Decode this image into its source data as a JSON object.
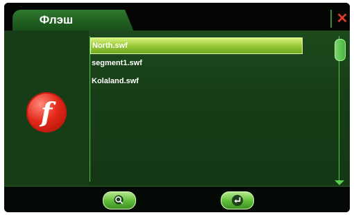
{
  "tab": {
    "title": "Флэш"
  },
  "close": {
    "icon": "close-icon",
    "glyph": "✕",
    "color": "#e23a2a"
  },
  "media_icon": {
    "icon": "flash-player-icon",
    "glyph": "f"
  },
  "file_list": {
    "items": [
      {
        "label": "North.swf",
        "selected": true
      },
      {
        "label": "segment1.swf",
        "selected": false
      },
      {
        "label": "Kolaland.swf",
        "selected": false
      }
    ]
  },
  "scrollbar": {
    "position": 0.0
  },
  "toolbar": {
    "search_icon": "search-icon",
    "back_icon": "enter-return-icon"
  },
  "colors": {
    "accent": "#5fbb38",
    "background": "#173e16",
    "selected": "#94c634"
  }
}
